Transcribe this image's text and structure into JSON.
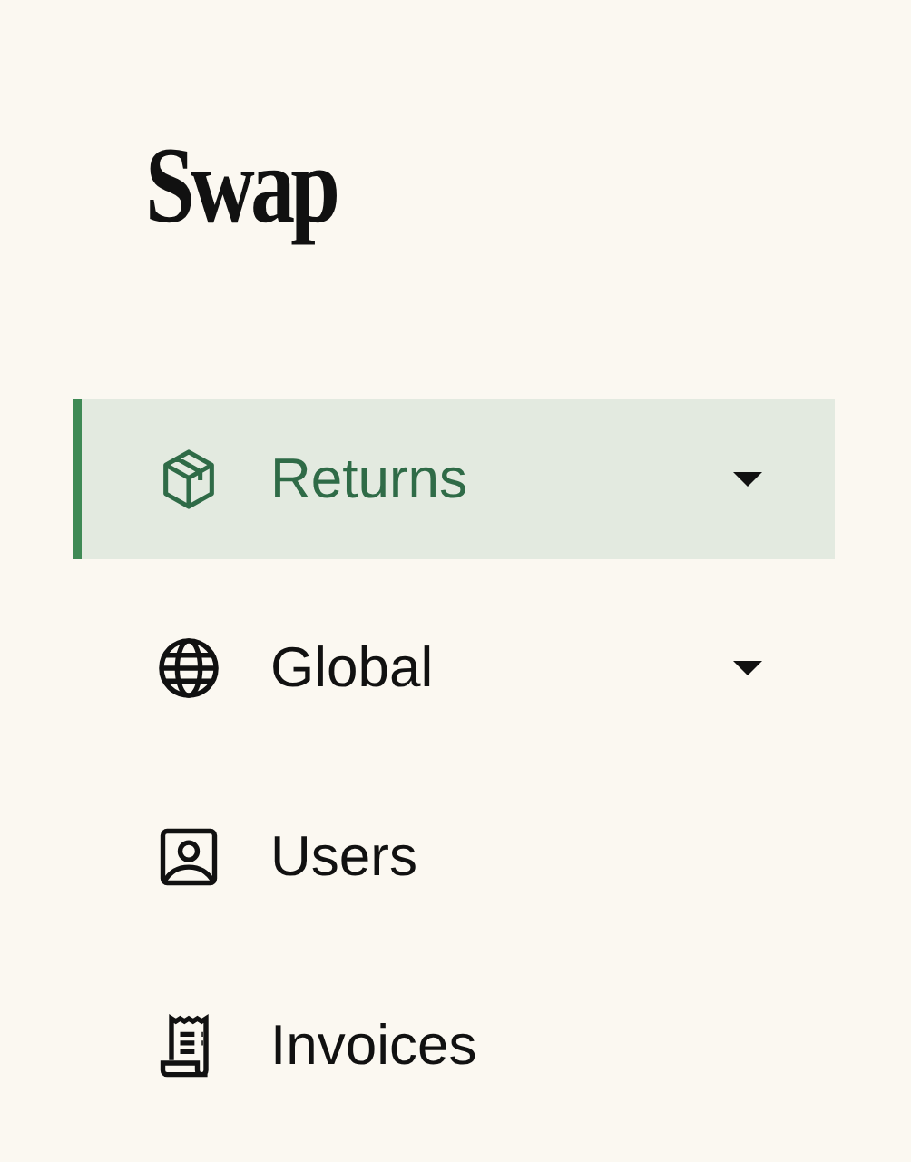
{
  "logo": "Swap",
  "nav": [
    {
      "label": "Returns",
      "selected": true,
      "expandable": true
    },
    {
      "label": "Global",
      "selected": false,
      "expandable": true
    },
    {
      "label": "Users",
      "selected": false,
      "expandable": false
    },
    {
      "label": "Invoices",
      "selected": false,
      "expandable": false
    }
  ]
}
